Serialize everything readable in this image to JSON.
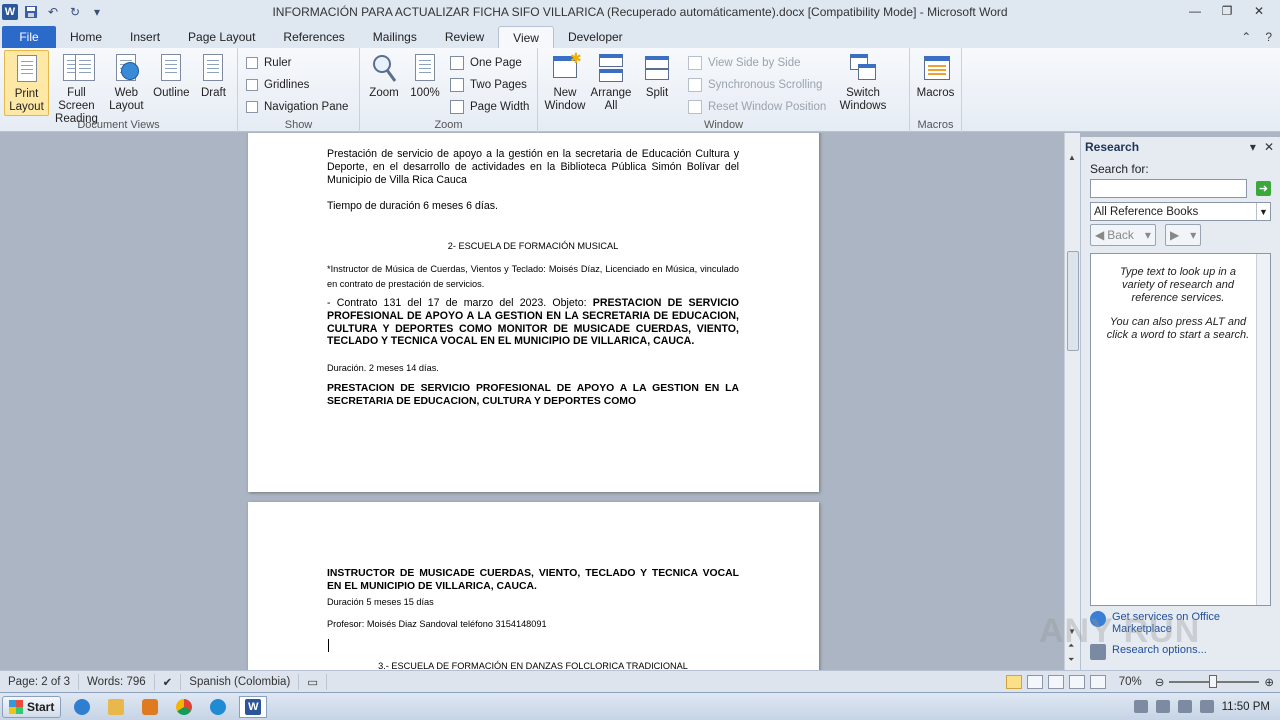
{
  "window": {
    "title": "INFORMACIÓN PARA ACTUALIZAR FICHA SIFO VILLARICA (Recuperado automáticamente).docx [Compatibility Mode] - Microsoft Word",
    "app_icon": "W"
  },
  "tabs": [
    "File",
    "Home",
    "Insert",
    "Page Layout",
    "References",
    "Mailings",
    "Review",
    "View",
    "Developer"
  ],
  "active_tab": "View",
  "ribbon": {
    "document_views": {
      "label": "Document Views",
      "print_layout": "Print Layout",
      "full_screen_reading": "Full Screen Reading",
      "web_layout": "Web Layout",
      "outline": "Outline",
      "draft": "Draft"
    },
    "show": {
      "label": "Show",
      "ruler": "Ruler",
      "gridlines": "Gridlines",
      "navigation_pane": "Navigation Pane"
    },
    "zoom": {
      "label": "Zoom",
      "zoom": "Zoom",
      "hundred": "100%",
      "one_page": "One Page",
      "two_pages": "Two Pages",
      "page_width": "Page Width"
    },
    "window": {
      "label": "Window",
      "new_window": "New Window",
      "arrange_all": "Arrange All",
      "split": "Split",
      "view_side_by_side": "View Side by Side",
      "synchronous_scrolling": "Synchronous Scrolling",
      "reset_window_position": "Reset Window Position",
      "switch_windows": "Switch Windows"
    },
    "macros": {
      "label": "Macros",
      "macros": "Macros"
    }
  },
  "document": {
    "page1": {
      "p1": "Prestación de servicio de apoyo a la gestión en la secretaria de Educación Cultura y Deporte, en el desarrollo de actividades en la Biblioteca Pública Simón Bolívar del Municipio de Villa Rica Cauca",
      "p2": "Tiempo de duración 6 meses 6 días.",
      "heading": "2- ESCUELA DE FORMACIÓN MUSICAL",
      "p3": "*Instructor de Música de Cuerdas, Vientos y Teclado: Moisés Díaz, Licenciado en Música, vinculado en contrato de prestación de servicios.",
      "p4_prefix": "- Contrato 131 del 17 de marzo del 2023. Objeto: ",
      "p4_bold": "PRESTACION DE SERVICIO PROFESIONAL DE APOYO A LA GESTION EN LA SECRETARIA DE EDUCACION, CULTURA Y DEPORTES COMO MONITOR DE MUSICADE CUERDAS, VIENTO, TECLADO Y TECNICA VOCAL EN EL MUNICIPIO DE VILLARICA, CAUCA.",
      "p5": "Duración. 2 meses 14 días.",
      "p6": "PRESTACION DE SERVICIO PROFESIONAL DE APOYO A LA GESTION EN LA SECRETARIA DE EDUCACION, CULTURA Y DEPORTES COMO"
    },
    "page2": {
      "p1": "INSTRUCTOR DE MUSICADE CUERDAS, VIENTO, TECLADO Y TECNICA VOCAL EN EL MUNICIPIO DE VILLARICA, CAUCA.",
      "p2": "Duración 5 meses 15 días",
      "p3": "Profesor: Moisés Diaz Sandoval teléfono 3154148091",
      "heading": "3.- ESCUELA DE FORMACIÓN EN DANZAS FOLCLORICA TRADICIONAL"
    }
  },
  "research": {
    "title": "Research",
    "search_for": "Search for:",
    "search_value": "",
    "source": "All Reference Books",
    "back": "Back",
    "msg1": "Type text to look up in a variety of research and reference services.",
    "msg2": "You can also press ALT and click a word to start a search.",
    "get_services": "Get services on Office Marketplace",
    "options": "Research options..."
  },
  "status": {
    "page": "Page: 2 of 3",
    "words": "Words: 796",
    "language": "Spanish (Colombia)",
    "zoom": "70%",
    "zoom_level": 0.7
  },
  "taskbar": {
    "start": "Start",
    "time": "11:50 PM"
  },
  "watermark": "ANY RUN"
}
